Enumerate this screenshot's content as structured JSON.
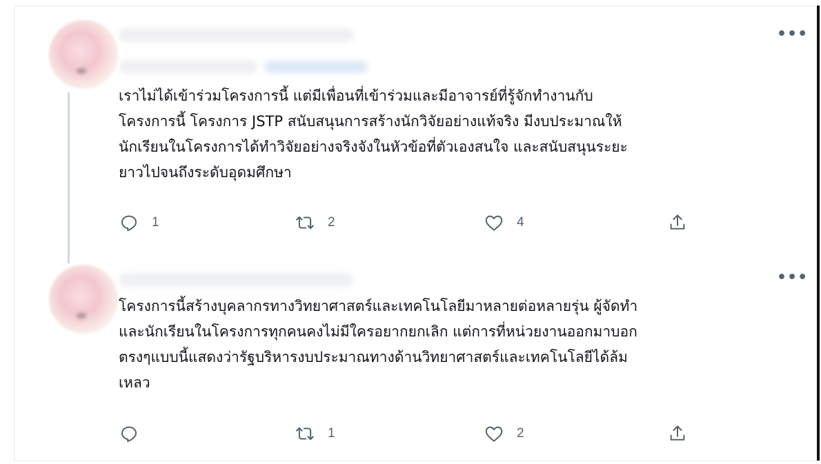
{
  "tweets": [
    {
      "more_label": "•••",
      "text": "เราไม่ได้เข้าร่วมโครงการนี้ แต่มีเพื่อนที่เข้าร่วมและมีอาจารย์ที่รู้จักทำงานกับ\nโครงการนี้ โครงการ JSTP สนับสนุนการสร้างนักวิจัยอย่างแท้จริง มีงบประมาณให้\nนักเรียนในโครงการได้ทำวิจัยอย่างจริงจังในหัวข้อที่ตัวเองสนใจ และสนับสนุนระยะ\nยาวไปจนถึงระดับอุดมศึกษา",
      "reply_count": "1",
      "retweet_count": "2",
      "like_count": "4"
    },
    {
      "more_label": "•••",
      "text": "โครงการนี้สร้างบุคลากรทางวิทยาศาสตร์และเทคโนโลยีมาหลายต่อหลายรุ่น ผู้จัดทำ\nและนักเรียนในโครงการทุกคนคงไม่มีใครอยากยกเลิก แต่การที่หน่วยงานออกมาบอก\nตรงๆแบบนี้แสดงว่ารัฐบริหารงบประมาณทางด้านวิทยาศาสตร์และเทคโนโลยีได้ล้ม\nเหลว",
      "reply_count": "",
      "retweet_count": "1",
      "like_count": "2"
    }
  ],
  "icons": {
    "reply": "reply-icon",
    "retweet": "retweet-icon",
    "like": "heart-icon",
    "share": "share-icon",
    "more": "more-icon"
  },
  "colors": {
    "icon_gray": "#536471",
    "text": "#0f1419",
    "thread_line": "#cfd9de"
  }
}
